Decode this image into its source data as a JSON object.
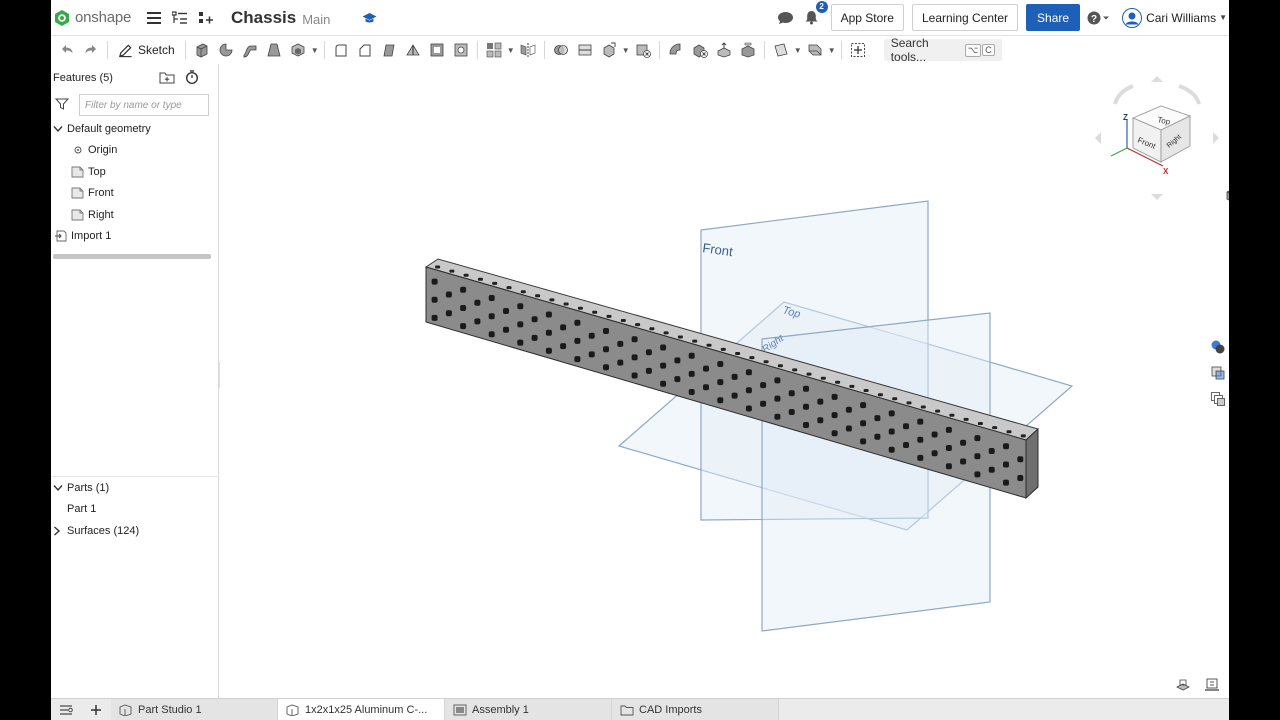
{
  "header": {
    "logo_text": "onshape",
    "doc_title": "Chassis",
    "branch": "Main",
    "notification_count": "2",
    "app_store_label": "App Store",
    "learning_center_label": "Learning Center",
    "share_label": "Share",
    "user_name": "Cari Williams",
    "help_icon": "help-icon",
    "accent_color": "#1e5fb8"
  },
  "toolbar": {
    "sketch_label": "Sketch",
    "search_label": "Search tools...",
    "search_shortcut_1": "⌥",
    "search_shortcut_2": "C"
  },
  "features": {
    "title": "Features (5)",
    "filter_placeholder": "Filter by name or type",
    "group_label": "Default geometry",
    "items": [
      {
        "label": "Origin",
        "icon": "origin-icon"
      },
      {
        "label": "Top",
        "icon": "plane-icon"
      },
      {
        "label": "Front",
        "icon": "plane-icon"
      },
      {
        "label": "Right",
        "icon": "plane-icon"
      }
    ],
    "import_label": "Import 1"
  },
  "parts": {
    "parts_label": "Parts (1)",
    "part_1": "Part 1",
    "surfaces_label": "Surfaces (124)"
  },
  "viewport": {
    "plane_front": "Front",
    "plane_top": "Top",
    "plane_right": "Right",
    "cube_top": "Top",
    "cube_front": "Front",
    "cube_right": "Right",
    "axis_z": "Z",
    "axis_x": "X"
  },
  "tabs": [
    {
      "label": "Part Studio 1",
      "active": false
    },
    {
      "label": "1x2x1x25 Aluminum C-...",
      "active": true
    },
    {
      "label": "Assembly 1",
      "active": false
    },
    {
      "label": "CAD Imports",
      "active": false
    }
  ]
}
